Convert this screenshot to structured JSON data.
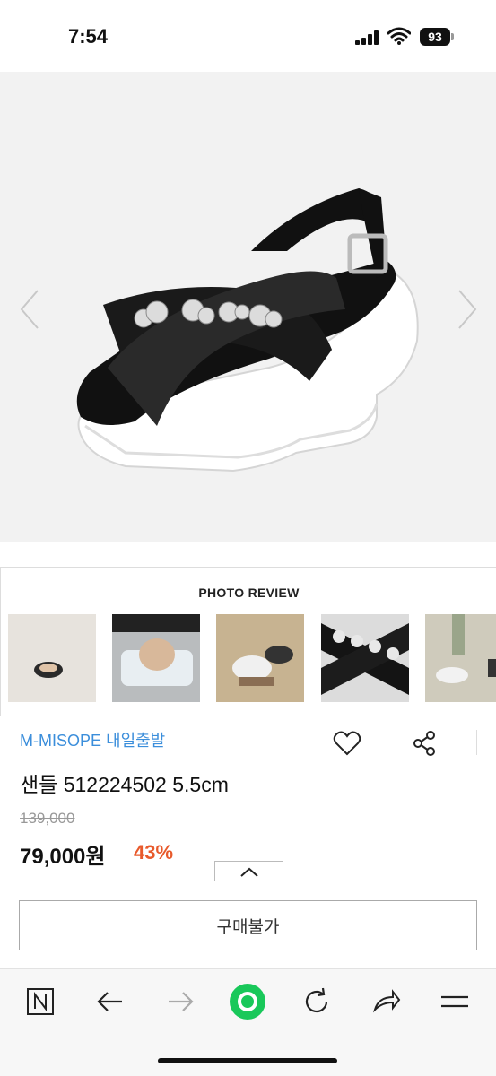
{
  "status_bar": {
    "time": "7:54",
    "battery": "93"
  },
  "photo_review": {
    "title": "PHOTO REVIEW"
  },
  "product": {
    "brand": "M-MISOPE 내일출발",
    "name": "샌들 512224502 5.5cm",
    "original_price": "139,000",
    "sale_price": "79,000원",
    "discount": "43%"
  },
  "buy_button_label": "구매불가",
  "icons": {
    "prev": "chevron-left-icon",
    "next": "chevron-right-icon",
    "heart": "heart-icon",
    "share": "share-icon",
    "collapse": "chevron-up-icon",
    "browser_home": "naver-n-icon",
    "back": "arrow-left-icon",
    "forward": "arrow-right-icon",
    "green": "green-circle-icon",
    "reload": "reload-icon",
    "send": "share-arrow-icon",
    "menu": "menu-icon"
  },
  "colors": {
    "brand": "#3b8edb",
    "discount": "#e85a2c",
    "green_button": "#19c85a"
  }
}
